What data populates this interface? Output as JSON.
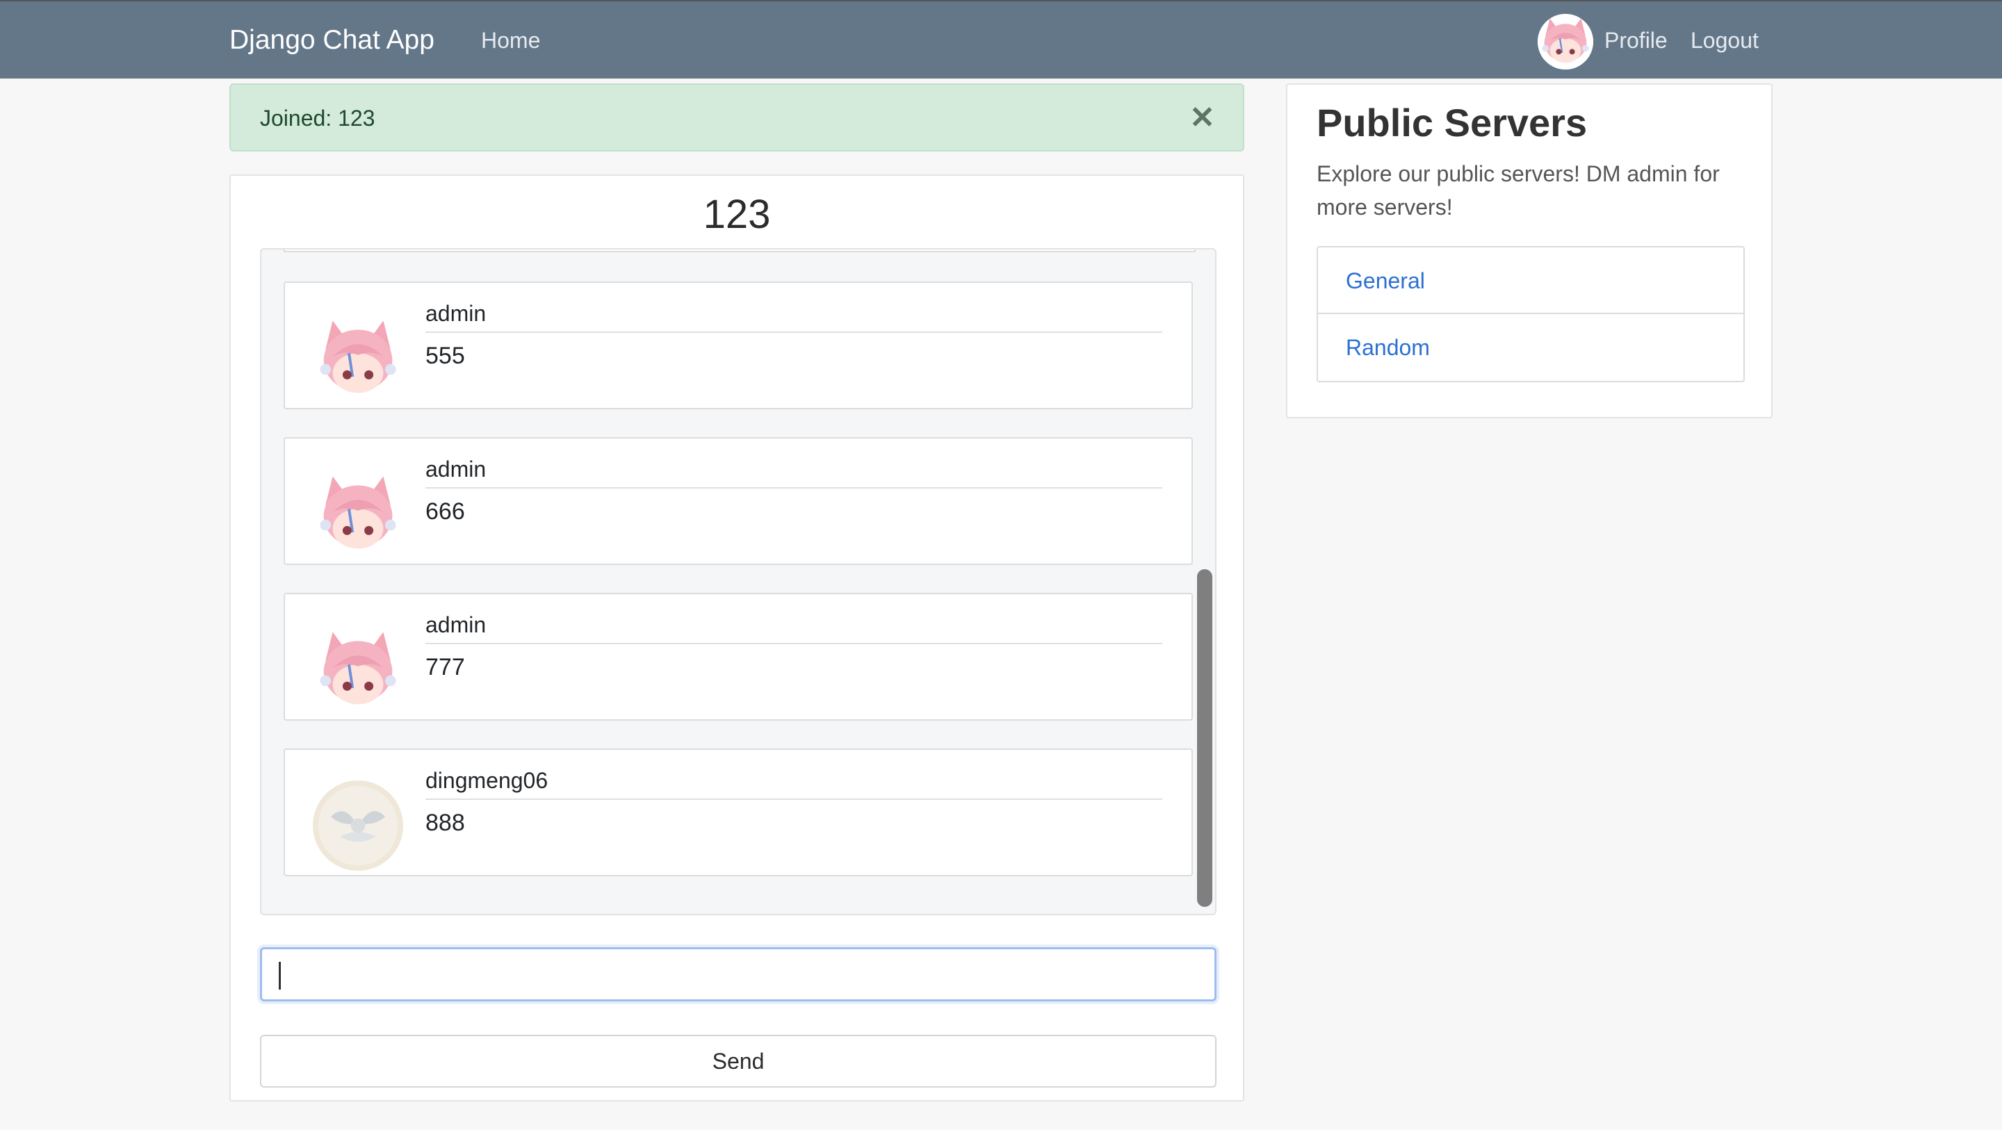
{
  "navbar": {
    "brand": "Django Chat App",
    "home": "Home",
    "profile": "Profile",
    "logout": "Logout",
    "avatar_icon": "anime-cat-girl-avatar"
  },
  "alert": {
    "text": "Joined: 123",
    "close": "✕"
  },
  "room": {
    "title": "123",
    "messages": [
      {
        "user": "admin",
        "text": "555",
        "avatar": "anime-cat-girl-avatar"
      },
      {
        "user": "admin",
        "text": "666",
        "avatar": "anime-cat-girl-avatar"
      },
      {
        "user": "admin",
        "text": "777",
        "avatar": "anime-cat-girl-avatar"
      },
      {
        "user": "dingmeng06",
        "text": "888",
        "avatar": "winged-emblem-avatar"
      }
    ],
    "input": {
      "value": "",
      "placeholder": ""
    },
    "send": "Send"
  },
  "servers": {
    "title": "Public Servers",
    "description": "Explore our public servers! DM admin for more servers!",
    "items": [
      "General",
      "Random"
    ]
  },
  "colors": {
    "navbar": "#647789",
    "alert_bg": "#d4eadb",
    "link": "#2c6fd3"
  }
}
